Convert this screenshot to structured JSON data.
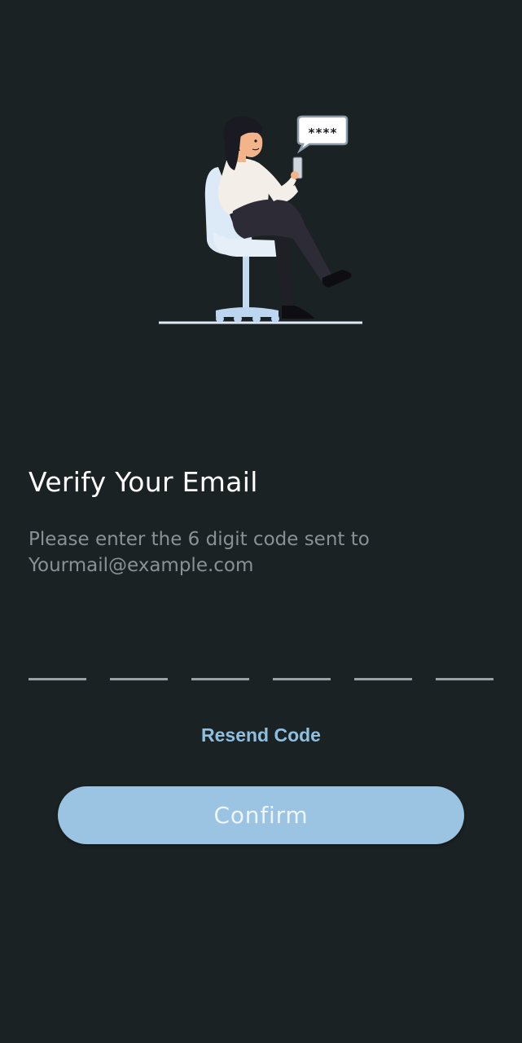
{
  "title": "Verify Your Email",
  "subtitle": {
    "line1": "Please enter the 6 digit code sent to",
    "line2": "Yourmail@example.com"
  },
  "otp": {
    "length": 6,
    "values": [
      "",
      "",
      "",
      "",
      "",
      ""
    ]
  },
  "resend_label": "Resend Code",
  "confirm_label": "Confirm",
  "colors": {
    "background": "#1b2224",
    "accent": "#9bc4e2",
    "link": "#8fbfe0",
    "muted_text": "#8a9196"
  },
  "illustration": {
    "bubble_text": "****"
  }
}
